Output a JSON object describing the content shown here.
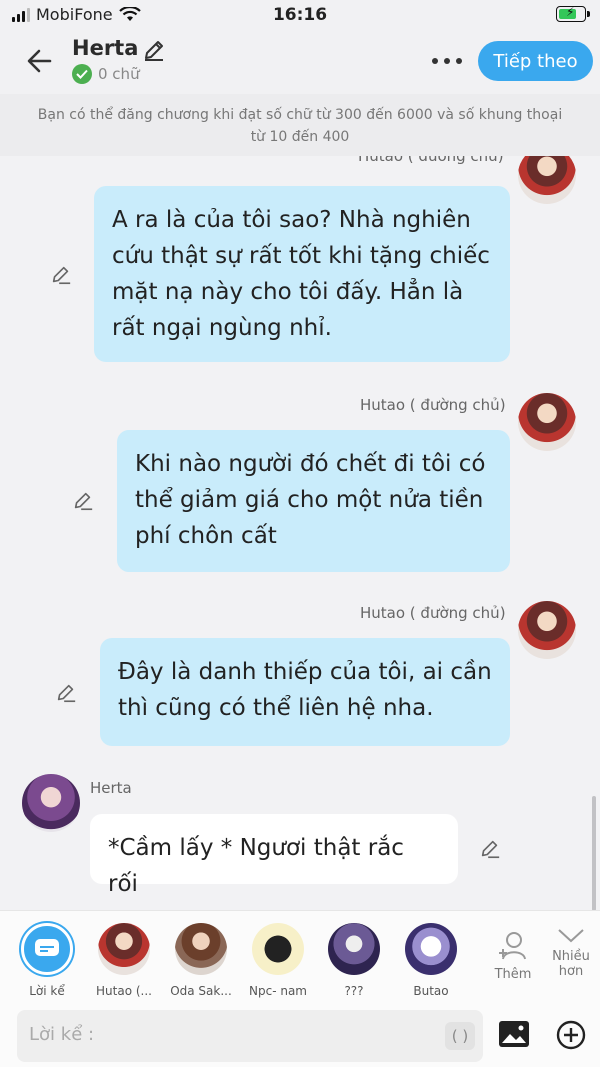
{
  "status": {
    "carrier": "MobiFone",
    "time": "16:16",
    "battery_level": 0.75
  },
  "header": {
    "title": "Herta",
    "word_count": "0 chữ",
    "next_label": "Tiếp theo"
  },
  "notice": {
    "line1": "Bạn có thể đăng chương khi đạt số chữ từ 300 đến 6000 và số khung thoại",
    "line2": "từ 10 đến 400"
  },
  "messages": [
    {
      "sender": "Hutao ( đường chủ)",
      "side": "right",
      "lines": [
        "A ra là của tôi sao? Nhà nghiên",
        "cứu thật sự rất tốt khi tặng chiếc",
        "mặt nạ này cho tôi đấy. Hẳn là",
        "rất ngại ngùng nhỉ."
      ]
    },
    {
      "sender": "Hutao ( đường chủ)",
      "side": "right",
      "lines": [
        "Khi nào người đó chết đi tôi có",
        "thể giảm giá cho một nửa tiền",
        "phí chôn cất"
      ]
    },
    {
      "sender": "Hutao ( đường chủ)",
      "side": "right",
      "lines": [
        "Đây là danh thiếp của tôi, ai cần",
        "thì cũng có thể liên hệ nha."
      ]
    },
    {
      "sender": "Herta",
      "side": "left",
      "lines": [
        "*Cầm lấy * Ngươi thật rắc rối"
      ]
    }
  ],
  "characters": [
    {
      "name": "Lời kể",
      "icon": "narration-icon"
    },
    {
      "name": "Hutao (...",
      "icon": "hutao-avatar"
    },
    {
      "name": "Oda Sak...",
      "icon": "oda-avatar"
    },
    {
      "name": "Npc- nam",
      "icon": "npc-avatar"
    },
    {
      "name": "???",
      "icon": "unknown-avatar"
    },
    {
      "name": "Butao",
      "icon": "butao-avatar"
    }
  ],
  "actions": {
    "add_label": "Thêm",
    "more_label_1": "Nhiều",
    "more_label_2": "hơn"
  },
  "input": {
    "placeholder": "Lời kể :",
    "paren": "( )"
  },
  "colors": {
    "accent": "#3aa8ee",
    "bubble_right": "#c9ecfb",
    "bubble_left": "#ffffff",
    "check": "#4caf50"
  }
}
